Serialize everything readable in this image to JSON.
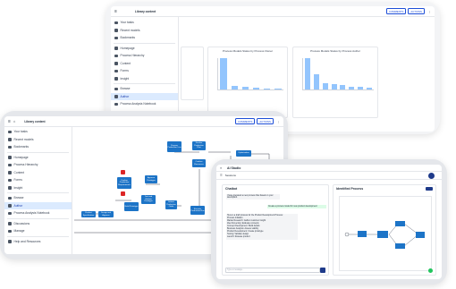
{
  "back_screen": {
    "header_title": "Library content",
    "header_buttons": [
      "COMMENTS",
      "ACTIONS"
    ],
    "sidebar_items": [
      "Your tasks",
      "Recent models",
      "Bookmarks",
      "Homepage",
      "Process Hierarchy",
      "Content",
      "Forms",
      "Insight",
      "Browse",
      "Author",
      "Process Analysis Notebook"
    ],
    "chart_titles": [
      "Process Models Status by Process Owner",
      "Process Models Status by Process Author"
    ]
  },
  "left_screen": {
    "header_title": "Library content",
    "header_buttons": [
      "COMMENTS",
      "ACTIONS"
    ],
    "sidebar_items": [
      "Your tasks",
      "Recent models",
      "Bookmarks",
      "Homepage",
      "Process Hierarchy",
      "Content",
      "Forms",
      "Insight",
      "Browse",
      "Author",
      "Process Analysis Notebook",
      "Discussions",
      "Manage",
      "Help and Resources"
    ],
    "active_item": "Author",
    "flow_nodes": [
      "Product Specification",
      "Design and Approve",
      "Confirm Production Requirements",
      "Build Prototype",
      "Test and Validate Prototype",
      "Approve Prototype",
      "Submit Production Order",
      "Prepare Production Line",
      "Finalize Production Plan",
      "Confirm Resources",
      "Execute Production Run",
      "Conduct Quality Checks",
      "Optimization"
    ]
  },
  "right_screen": {
    "app_title": "AI Studio",
    "toolbar_label": "Sessions",
    "chat_title": "Chatbot",
    "process_title": "Identified Process",
    "chat_intro": "I have prepared a new process flow based on your description.",
    "chat_user_msg": "Create a process model for new product development",
    "chat_body": [
      "Here is a draft process for the Product Development Process:",
      "Process Initiation",
      "Market Research: Gather customer insight",
      "Idea Screening: Evaluate concepts",
      "Concept Development: Build details",
      "Business Analysis: Assess viability",
      "Product Development: Create prototype",
      "Testing: Validate design",
      "Launch: Release product"
    ],
    "input_placeholder": "Type a message..."
  },
  "chart_data": [
    {
      "type": "bar",
      "title": "Process Models Status by Process Owner",
      "categories": [
        "c1",
        "c2",
        "c3",
        "c4",
        "c5",
        "c6"
      ],
      "values": [
        55,
        6,
        5,
        3,
        2,
        1
      ]
    },
    {
      "type": "bar",
      "title": "Process Models Status by Process Author",
      "categories": [
        "c1",
        "c2",
        "c3",
        "c4",
        "c5",
        "c6",
        "c7",
        "c8"
      ],
      "values": [
        60,
        30,
        12,
        10,
        8,
        6,
        5,
        4
      ]
    }
  ]
}
